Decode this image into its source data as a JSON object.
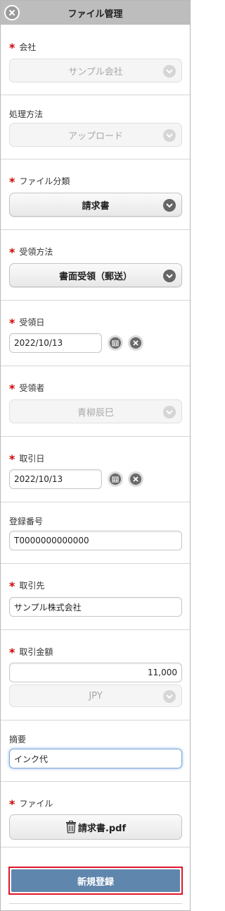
{
  "header": {
    "title": "ファイル管理",
    "close_icon": "close-icon"
  },
  "required_mark": "*",
  "fields": {
    "company": {
      "label": "会社",
      "value": "サンプル会社"
    },
    "processing_method": {
      "label": "処理方法",
      "value": "アップロード"
    },
    "file_category": {
      "label": "ファイル分類",
      "value": "請求書"
    },
    "receipt_method": {
      "label": "受領方法",
      "value": "書面受領（郵送）"
    },
    "receipt_date": {
      "label": "受領日",
      "value": "2022/10/13"
    },
    "recipient": {
      "label": "受領者",
      "value": "青柳辰巳"
    },
    "transaction_date": {
      "label": "取引日",
      "value": "2022/10/13"
    },
    "registration_number": {
      "label": "登録番号",
      "value": "T0000000000000"
    },
    "counterparty": {
      "label": "取引先",
      "value": "サンプル株式会社"
    },
    "transaction_amount": {
      "label": "取引金額",
      "value": "11,000",
      "currency": "JPY"
    },
    "summary": {
      "label": "摘要",
      "value": "インク代"
    },
    "file": {
      "label": "ファイル",
      "file_name": "請求書.pdf"
    }
  },
  "submit": {
    "label": "新規登録"
  },
  "colors": {
    "header_bg": "#bdbdbd",
    "required": "#d00000",
    "submit_bg": "#5f86ad",
    "highlight_border": "#e0162b"
  }
}
